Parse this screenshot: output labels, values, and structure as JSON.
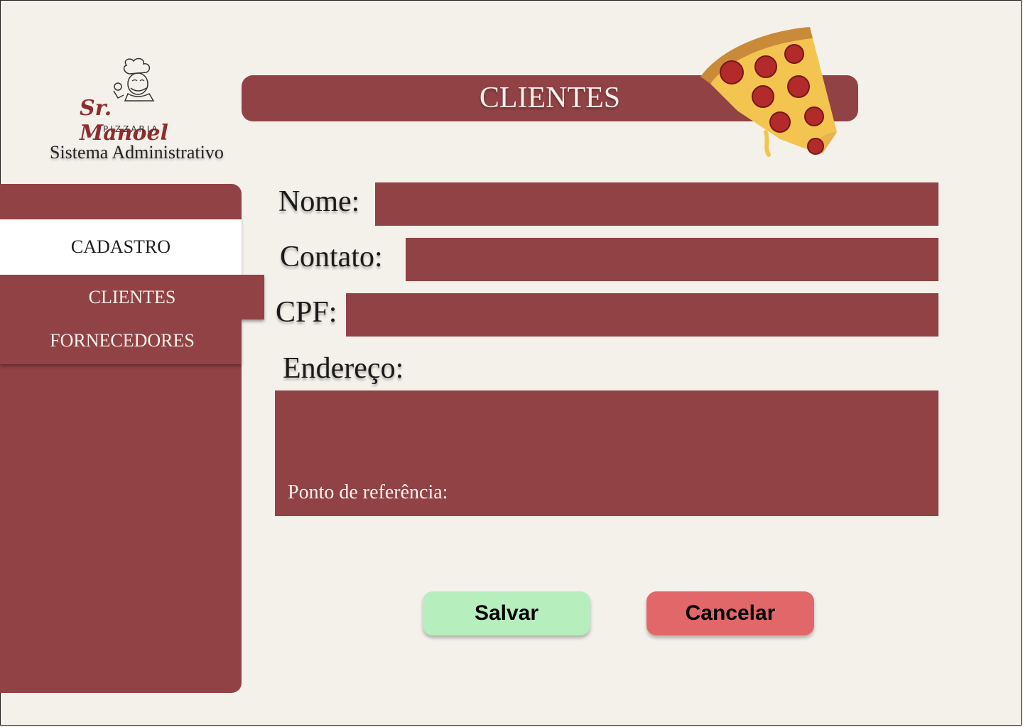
{
  "brand": {
    "name": "Sr. Manoel",
    "subtitle": "PIZZARIA",
    "system_title": "Sistema Administrativo"
  },
  "header": {
    "title": "CLIENTES"
  },
  "sidebar": {
    "items": [
      {
        "label": "CADASTRO",
        "active": true
      },
      {
        "label": "CLIENTES"
      },
      {
        "label": "FORNECEDORES"
      }
    ]
  },
  "form": {
    "nome": {
      "label": "Nome:",
      "value": ""
    },
    "contato": {
      "label": "Contato:",
      "value": ""
    },
    "cpf": {
      "label": "CPF:",
      "value": ""
    },
    "endereco": {
      "label": "Endereço:",
      "reference_label": "Ponto de referência:"
    }
  },
  "actions": {
    "save_label": "Salvar",
    "cancel_label": "Cancelar"
  },
  "colors": {
    "primary": "#914244",
    "background": "#f4f1eb",
    "save": "#b6eebe",
    "cancel": "#e26769"
  }
}
